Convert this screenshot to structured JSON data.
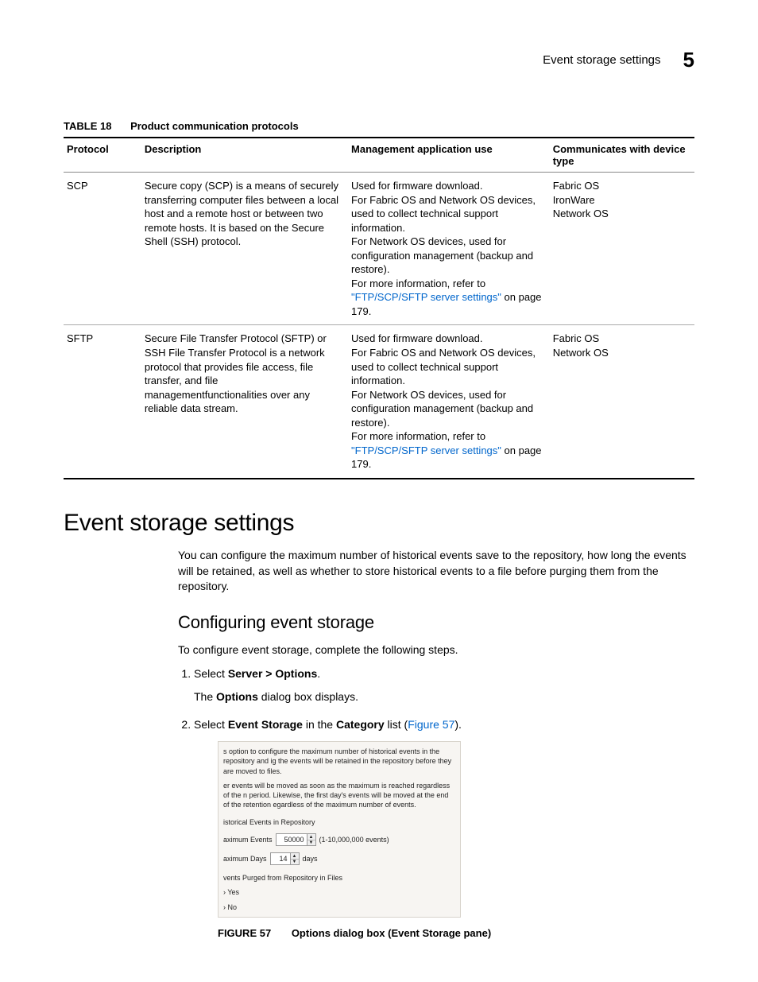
{
  "header": {
    "running_title": "Event storage settings",
    "chapter_num": "5"
  },
  "table": {
    "label": "TABLE 18",
    "title": "Product communication protocols",
    "columns": {
      "protocol": "Protocol",
      "description": "Description",
      "use": "Management application use",
      "device": "Communicates with device type"
    },
    "rows": [
      {
        "protocol": "SCP",
        "description": "Secure copy (SCP) is a means of securely transferring computer files between a local host and a remote host or between two remote hosts. It is based on the Secure Shell (SSH) protocol.",
        "use_pre": "Used for firmware download.\nFor Fabric OS and Network OS devices, used to collect technical support information.\nFor Network OS devices, used for configuration management (backup and restore).\nFor more information, refer to ",
        "use_link": "\"FTP/SCP/SFTP server settings\"",
        "use_post": " on page 179.",
        "devices": "Fabric OS\nIronWare\nNetwork OS"
      },
      {
        "protocol": "SFTP",
        "description": "Secure File Transfer Protocol (SFTP) or SSH File Transfer Protocol is a network protocol that provides file access, file transfer, and file managementfunctionalities over any reliable data stream.",
        "use_pre": "Used for firmware download.\nFor Fabric OS and Network OS devices, used to collect technical support information.\nFor Network OS devices, used for configuration management (backup and restore).\nFor more information, refer to ",
        "use_link": "\"FTP/SCP/SFTP server settings\"",
        "use_post": " on page 179.",
        "devices": "Fabric OS\nNetwork OS"
      }
    ]
  },
  "section": {
    "title": "Event storage settings",
    "intro": "You can configure the maximum number of historical events save to the repository, how long the events will be retained, as well as whether to store historical events to a file before purging them from the repository.",
    "sub_title": "Configuring event storage",
    "sub_intro": "To configure event storage, complete the following steps.",
    "step1_pre": "Select ",
    "step1_bold": "Server > Options",
    "step1_post": ".",
    "step1_sub_pre": "The ",
    "step1_sub_bold": "Options",
    "step1_sub_post": " dialog box displays.",
    "step2_pre": "Select ",
    "step2_bold1": "Event Storage",
    "step2_mid": " in the ",
    "step2_bold2": "Category",
    "step2_post1": " list (",
    "step2_link": "Figure 57",
    "step2_post2": ")."
  },
  "figure": {
    "para1": "s option to configure the maximum number of historical events in the repository and ig the events will be retained in the repository before they are moved to files.",
    "para2": "er events will be moved as soon as the maximum is reached regardless of the n period. Likewise, the first day's events will be moved at the end of the retention egardless of the maximum number of events.",
    "section1": "istorical Events in Repository",
    "max_events_label": "aximum Events",
    "max_events_value": "50000",
    "max_events_range": "(1-10,000,000 events)",
    "max_days_label": "aximum Days",
    "max_days_value": "14",
    "max_days_unit": "days",
    "section2": "vents Purged from Repository in Files",
    "radio_yes": "Yes",
    "radio_no": "No",
    "caption_label": "FIGURE 57",
    "caption_text": "Options dialog box (Event Storage pane)"
  }
}
